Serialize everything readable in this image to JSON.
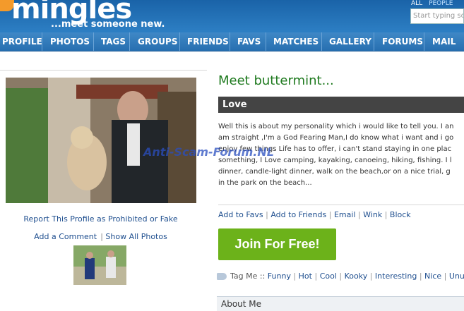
{
  "header": {
    "logo": "mingles",
    "tagline": "...meet someone new.",
    "search_tabs": [
      "ALL",
      "PEOPLE"
    ],
    "search_placeholder": "Start typing so"
  },
  "nav": [
    "PROFILE",
    "PHOTOS",
    "TAGS",
    "GROUPS",
    "FRIENDS",
    "FAVS",
    "MATCHES",
    "GALLERY",
    "FORUMS",
    "MAIL"
  ],
  "left": {
    "report_link": "Report This Profile as Prohibited or Fake",
    "add_comment": "Add a Comment",
    "show_photos": "Show All Photos"
  },
  "profile": {
    "heading": "Meet buttermint...",
    "section_title": "Love",
    "bio_lines": [
      "Well this is about my personality which i would like to tell you. I an",
      "am straight ,I'm a God Fearing Man,I do know what i want and i go",
      "enjoy few things Life has to offer, i can't stand staying in one plac",
      "something, I Love camping, kayaking, canoeing, hiking, fishing. I l",
      "dinner, candle-light dinner, walk on the beach,or on a nice trial, g",
      "in the park on the beach..."
    ],
    "watermark": "Anti-Scam-Forum.NL",
    "actions": [
      "Add to Favs",
      "Add to Friends",
      "Email",
      "Wink",
      "Block"
    ],
    "join_button": "Join For Free!",
    "tag_label": "Tag Me ::",
    "tags": [
      "Funny",
      "Hot",
      "Cool",
      "Kooky",
      "Interesting",
      "Nice",
      "Unus"
    ],
    "about_title": "About Me"
  },
  "colors": {
    "header_blue": "#1a63a8",
    "heading_green": "#1f7a1f",
    "join_green": "#6cb21a",
    "link_blue": "#1f4f8f"
  }
}
